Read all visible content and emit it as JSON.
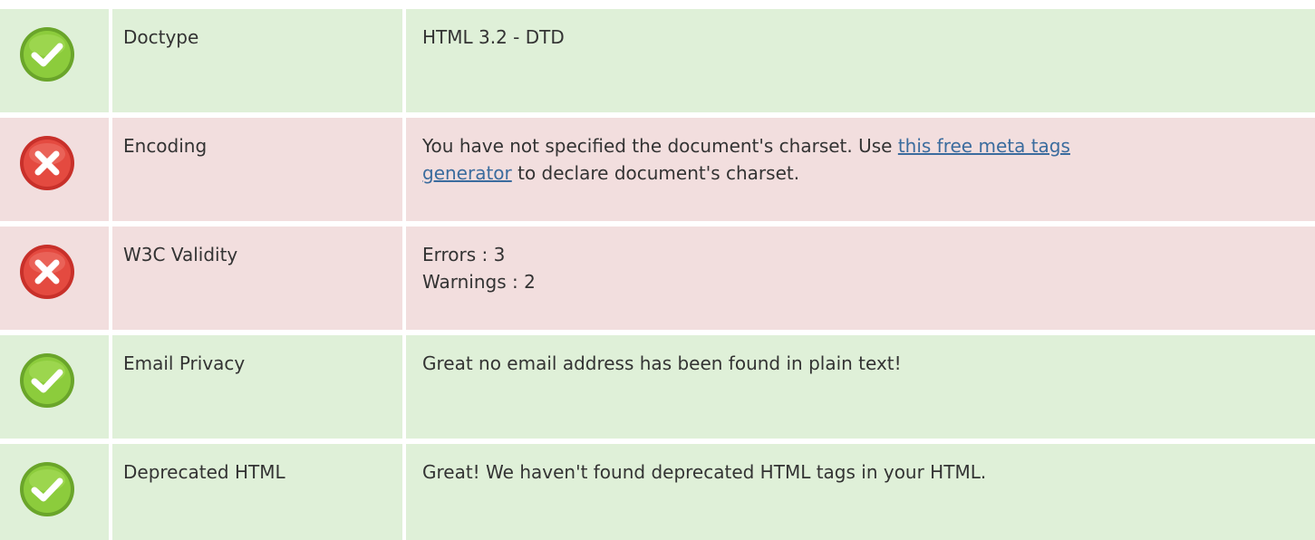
{
  "rows": [
    {
      "status": "pass",
      "icon": "check-circle-icon",
      "label": "Doctype",
      "value": "HTML 3.2 - DTD"
    },
    {
      "status": "fail",
      "icon": "x-circle-icon",
      "label": "Encoding",
      "value_before_link": "You have not specified the document's charset. Use ",
      "link_text_line1": "this free meta tags",
      "link_text_line2": "generator",
      "value_after_link": " to declare document's charset."
    },
    {
      "status": "fail",
      "icon": "x-circle-icon",
      "label": "W3C Validity",
      "errors": "Errors : 3",
      "warnings": "Warnings : 2"
    },
    {
      "status": "pass",
      "icon": "check-circle-icon",
      "label": "Email Privacy",
      "value": "Great no email address has been found in plain text!"
    },
    {
      "status": "pass",
      "icon": "check-circle-icon",
      "label": "Deprecated HTML",
      "value": "Great! We haven't found deprecated HTML tags in your HTML."
    }
  ],
  "colors": {
    "pass_bg": "#dff0d8",
    "fail_bg": "#f2dede",
    "pass_icon": "#7cb82f",
    "fail_icon": "#e0403a",
    "link": "#3b6c9e",
    "text": "#333333"
  }
}
